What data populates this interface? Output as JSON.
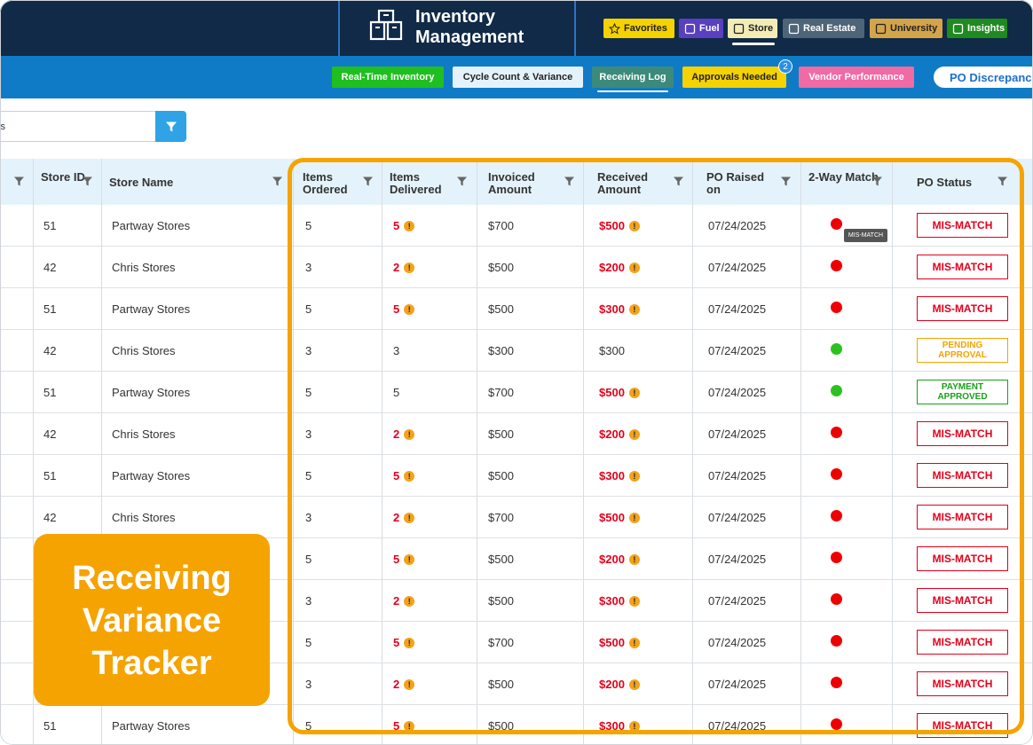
{
  "app": {
    "title": "Inventory Management"
  },
  "modules": [
    {
      "label": "Favorites",
      "bg": "#f5d200",
      "fg": "#222222"
    },
    {
      "label": "Fuel",
      "bg": "#5a3fc0",
      "fg": "#ffffff"
    },
    {
      "label": "Store",
      "bg": "#f3ecb6",
      "fg": "#222222"
    },
    {
      "label": "Real Estate",
      "bg": "#4e6477",
      "fg": "#ffffff"
    },
    {
      "label": "University",
      "bg": "#d4a44a",
      "fg": "#222222"
    },
    {
      "label": "Insights",
      "bg": "#1f8a1f",
      "fg": "#ffffff"
    }
  ],
  "tabs": [
    {
      "label": "Real-Time Inventory",
      "bg": "#1fbf1f",
      "fg": "#ffffff"
    },
    {
      "label": "Cycle Count & Variance",
      "bg": "#e4f3fb",
      "fg": "#222222"
    },
    {
      "label": "Receiving Log",
      "bg": "#3c8a7a",
      "fg": "#ffffff"
    },
    {
      "label": "Approvals Needed",
      "bg": "#f5d200",
      "fg": "#222222"
    },
    {
      "label": "Vendor Performance",
      "bg": "#f06aa4",
      "fg": "#ffffff"
    },
    {
      "label": "PO Discrepanci",
      "bg": "#ffffff",
      "fg": "#1a6fd0"
    }
  ],
  "approvals_badge": "2",
  "search": {
    "value": "rders"
  },
  "columns": [
    {
      "label": ""
    },
    {
      "label": "Store ID"
    },
    {
      "label": "Store Name"
    },
    {
      "label": "Items Ordered"
    },
    {
      "label": "Items Delivered"
    },
    {
      "label": "Invoiced Amount"
    },
    {
      "label": "Received Amount"
    },
    {
      "label": "PO Raised on"
    },
    {
      "label": "2-Way Match"
    },
    {
      "label": "PO Status"
    }
  ],
  "rows": [
    {
      "store_id": "51",
      "store_name": "Partway Stores",
      "ordered": "5",
      "delivered": "5",
      "delivered_flag": true,
      "invoiced": "$700",
      "received": "$500",
      "received_flag": true,
      "raised": "07/24/2025",
      "match": "red",
      "status": "MIS-MATCH",
      "status_type": "mis"
    },
    {
      "store_id": "42",
      "store_name": "Chris Stores",
      "ordered": "3",
      "delivered": "2",
      "delivered_flag": true,
      "invoiced": "$500",
      "received": "$200",
      "received_flag": true,
      "raised": "07/24/2025",
      "match": "red",
      "status": "MIS-MATCH",
      "status_type": "mis"
    },
    {
      "store_id": "51",
      "store_name": "Partway Stores",
      "ordered": "5",
      "delivered": "5",
      "delivered_flag": true,
      "invoiced": "$500",
      "received": "$300",
      "received_flag": true,
      "raised": "07/24/2025",
      "match": "red",
      "status": "MIS-MATCH",
      "status_type": "mis"
    },
    {
      "store_id": "42",
      "store_name": "Chris Stores",
      "ordered": "3",
      "delivered": "3",
      "delivered_flag": false,
      "invoiced": "$300",
      "received": "$300",
      "received_flag": false,
      "raised": "07/24/2025",
      "match": "green",
      "status": "PENDING APPROVAL",
      "status_type": "pend"
    },
    {
      "store_id": "51",
      "store_name": "Partway Stores",
      "ordered": "5",
      "delivered": "5",
      "delivered_flag": false,
      "invoiced": "$700",
      "received": "$500",
      "received_flag": true,
      "raised": "07/24/2025",
      "match": "green",
      "status": "PAYMENT APPROVED",
      "status_type": "pay"
    },
    {
      "store_id": "42",
      "store_name": "Chris Stores",
      "ordered": "3",
      "delivered": "2",
      "delivered_flag": true,
      "invoiced": "$500",
      "received": "$200",
      "received_flag": true,
      "raised": "07/24/2025",
      "match": "red",
      "status": "MIS-MATCH",
      "status_type": "mis"
    },
    {
      "store_id": "51",
      "store_name": "Partway Stores",
      "ordered": "5",
      "delivered": "5",
      "delivered_flag": true,
      "invoiced": "$500",
      "received": "$300",
      "received_flag": true,
      "raised": "07/24/2025",
      "match": "red",
      "status": "MIS-MATCH",
      "status_type": "mis"
    },
    {
      "store_id": "42",
      "store_name": "Chris Stores",
      "ordered": "3",
      "delivered": "2",
      "delivered_flag": true,
      "invoiced": "$700",
      "received": "$500",
      "received_flag": true,
      "raised": "07/24/2025",
      "match": "red",
      "status": "MIS-MATCH",
      "status_type": "mis"
    },
    {
      "store_id": "",
      "store_name": "",
      "ordered": "5",
      "delivered": "5",
      "delivered_flag": true,
      "invoiced": "$500",
      "received": "$200",
      "received_flag": true,
      "raised": "07/24/2025",
      "match": "red",
      "status": "MIS-MATCH",
      "status_type": "mis"
    },
    {
      "store_id": "",
      "store_name": "",
      "ordered": "3",
      "delivered": "2",
      "delivered_flag": true,
      "invoiced": "$500",
      "received": "$300",
      "received_flag": true,
      "raised": "07/24/2025",
      "match": "red",
      "status": "MIS-MATCH",
      "status_type": "mis"
    },
    {
      "store_id": "",
      "store_name": "",
      "ordered": "5",
      "delivered": "5",
      "delivered_flag": true,
      "invoiced": "$700",
      "received": "$500",
      "received_flag": true,
      "raised": "07/24/2025",
      "match": "red",
      "status": "MIS-MATCH",
      "status_type": "mis"
    },
    {
      "store_id": "",
      "store_name": "",
      "ordered": "3",
      "delivered": "2",
      "delivered_flag": true,
      "invoiced": "$500",
      "received": "$200",
      "received_flag": true,
      "raised": "07/24/2025",
      "match": "red",
      "status": "MIS-MATCH",
      "status_type": "mis"
    },
    {
      "store_id": "51",
      "store_name": "Partway Stores",
      "ordered": "5",
      "delivered": "5",
      "delivered_flag": true,
      "invoiced": "$500",
      "received": "$300",
      "received_flag": true,
      "raised": "07/24/2025",
      "match": "red",
      "status": "MIS-MATCH",
      "status_type": "mis"
    }
  ],
  "tooltip": "MIS-MATCH",
  "callout": "Receiving Variance Tracker",
  "colors": {
    "accent": "#f5a300",
    "mismatch": "#e3001b",
    "match_ok": "#2bc21f",
    "header_bg": "#102a47",
    "subbar_bg": "#0f7bc7"
  }
}
